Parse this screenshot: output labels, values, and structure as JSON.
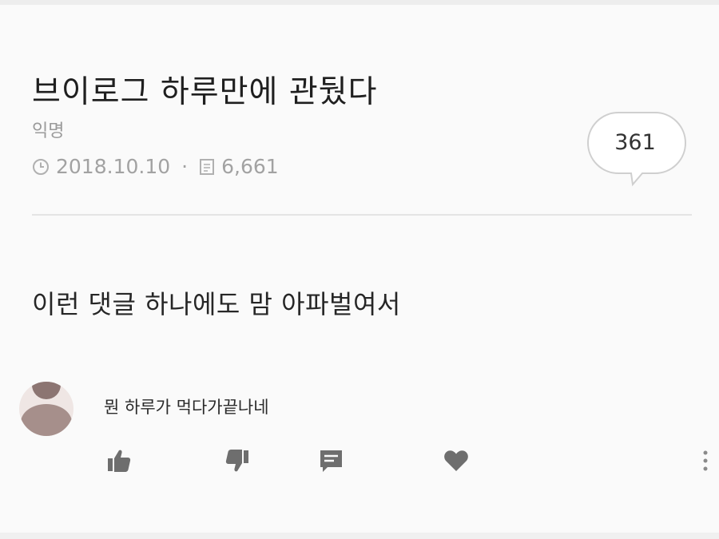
{
  "post": {
    "title": "브이로그 하루만에 관뒀다",
    "author": "익명",
    "date": "2018.10.10",
    "separator": "·",
    "views": "6,661",
    "comment_count": "361",
    "body": "이런 댓글 하나에도 맘 아파벌여서"
  },
  "comment": {
    "text": "뭔 하루가 먹다가끝나네"
  },
  "icons": {
    "clock": "clock-icon",
    "document": "document-icon",
    "speech_bubble": "speech-bubble-icon",
    "like": "thumbs-up-icon",
    "dislike": "thumbs-down-icon",
    "reply": "reply-icon",
    "heart": "heart-icon",
    "more": "more-vertical-icon"
  },
  "colors": {
    "text_dark": "#222222",
    "meta_gray": "#a2a2a2",
    "icon_gray": "#6e6e6e",
    "divider": "#e4e4e4"
  }
}
